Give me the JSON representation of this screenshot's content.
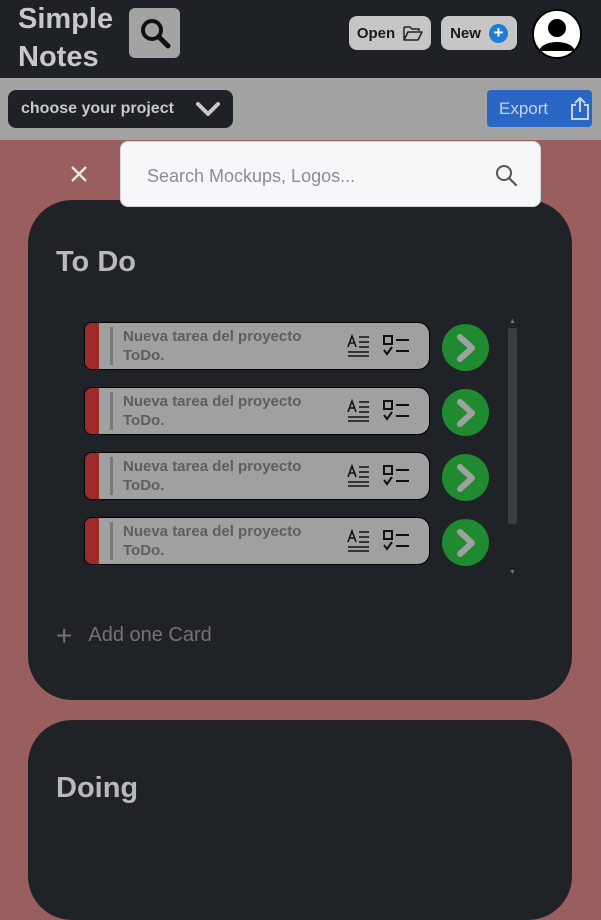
{
  "header": {
    "app_title": "Simple Notes",
    "open_label": "Open",
    "new_label": "New"
  },
  "project_bar": {
    "project_select": "choose your project",
    "export_label": "Export"
  },
  "search": {
    "placeholder": "Search Mockups, Logos..."
  },
  "columns": [
    {
      "title": "To Do",
      "cards": [
        {
          "text": "Nueva tarea del proyecto ToDo."
        },
        {
          "text": "Nueva tarea del proyecto ToDo."
        },
        {
          "text": "Nueva tarea del proyecto ToDo."
        },
        {
          "text": "Nueva tarea del proyecto ToDo."
        }
      ],
      "add_label": "Add one Card"
    },
    {
      "title": "Doing"
    }
  ],
  "colors": {
    "background": "#9b5e5e",
    "header": "#1e2125",
    "accent_blue": "#2a66c4",
    "card_stripe": "#9e2a2a",
    "go_green": "#1f8a2f"
  }
}
